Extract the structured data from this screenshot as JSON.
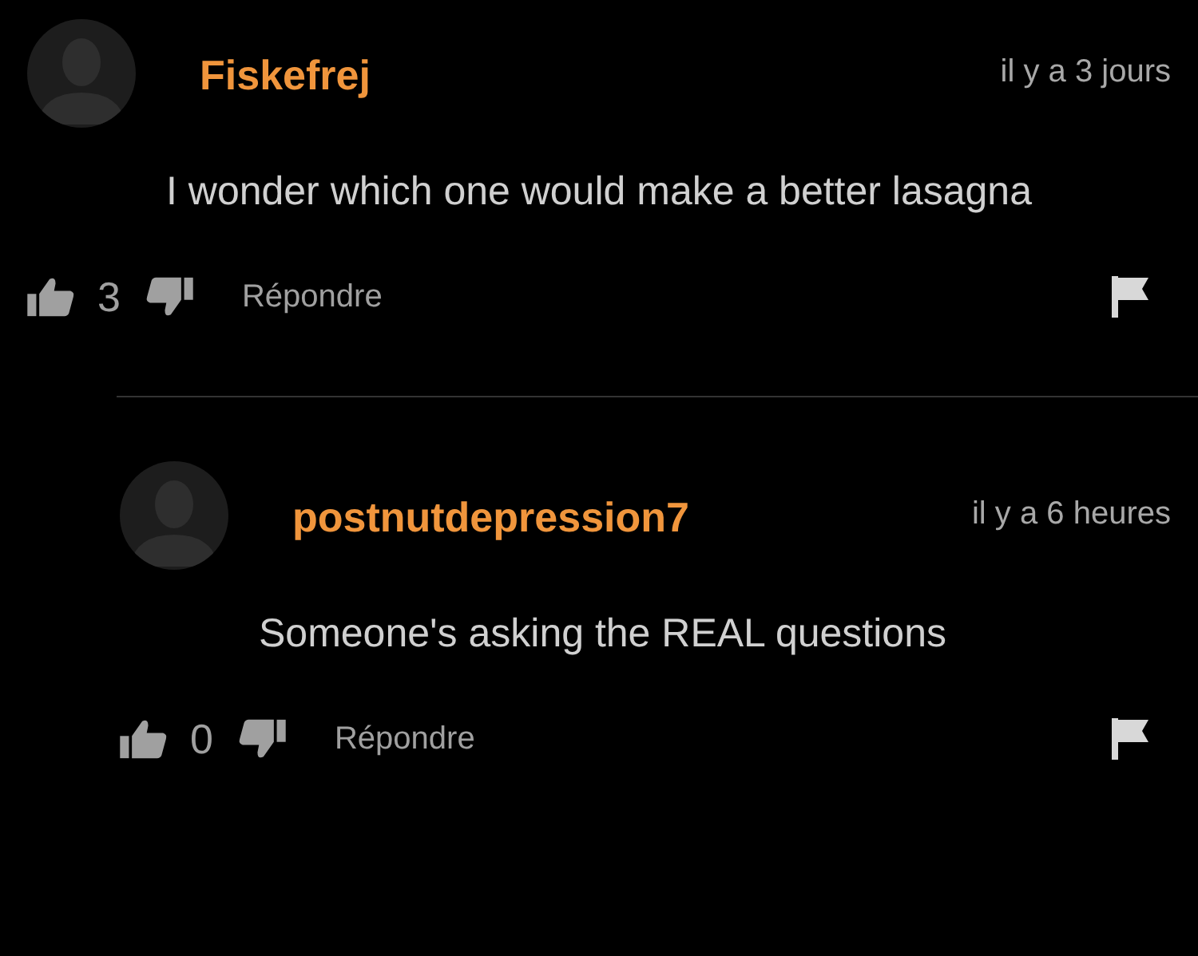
{
  "comments": [
    {
      "author": "Fiskefrej",
      "time": "il y a 3 jours",
      "text": "I wonder which one would make a better lasagna",
      "likes": "3",
      "reply_label": "Répondre",
      "children": [
        {
          "author": "postnutdepression7",
          "time": "il y a 6 heures",
          "text": "Someone's asking the REAL questions",
          "likes": "0",
          "reply_label": "Répondre"
        }
      ]
    }
  ]
}
